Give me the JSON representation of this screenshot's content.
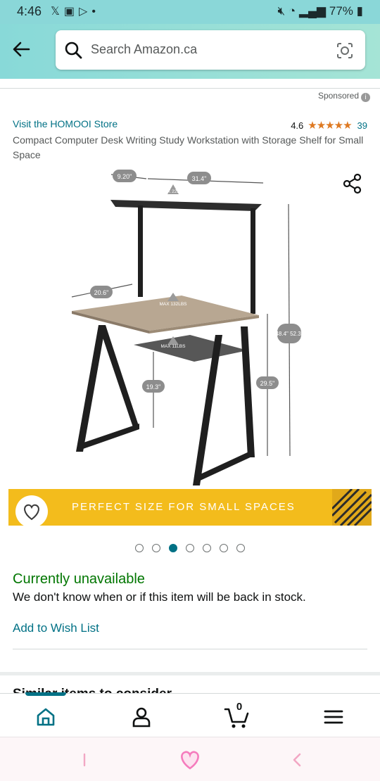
{
  "status_bar": {
    "time": "4:46",
    "left_icons": [
      "x-logo-icon",
      "gallery-icon",
      "play-store-icon",
      "dot-icon"
    ],
    "battery": "77%"
  },
  "header": {
    "search_placeholder": "Search Amazon.ca"
  },
  "product": {
    "sponsored_label": "Sponsored",
    "store_link": "Visit the HOMOOI Store",
    "rating": "4.6",
    "stars": "★★★★★",
    "rating_count": "39",
    "title": "Compact Computer Desk Writing Study Workstation with Storage Shelf for Small Space",
    "image_labels": {
      "shelf_depth": "9.20\"",
      "shelf_width": "31.4\"",
      "shelf_max": "MAX 22LBS",
      "desk_depth": "20.6\"",
      "desk_max": "MAX 132LBS",
      "basket_max": "MAX 11LBS",
      "under_height": "19.3\"",
      "desk_height": "29.5\"",
      "total_height": "48.4\" 52.3\""
    },
    "banner_text": "PERFECT SIZE FOR SMALL SPACES",
    "carousel": {
      "count": 7,
      "active_index": 2
    },
    "availability": "Currently unavailable",
    "stock_note": "We don't know when or if this item will be back in stock.",
    "wishlist_label": "Add to Wish List",
    "next_section_peek": "Similar items to consider"
  },
  "bottom_nav": {
    "items": [
      "home-icon",
      "account-icon",
      "cart-icon",
      "menu-icon"
    ],
    "active": "home",
    "cart_count": "0"
  },
  "colors": {
    "header_bg": "#88d9d8",
    "link": "#007185",
    "available_green": "#007600",
    "star": "#de7921",
    "banner": "#f3bc1c"
  }
}
